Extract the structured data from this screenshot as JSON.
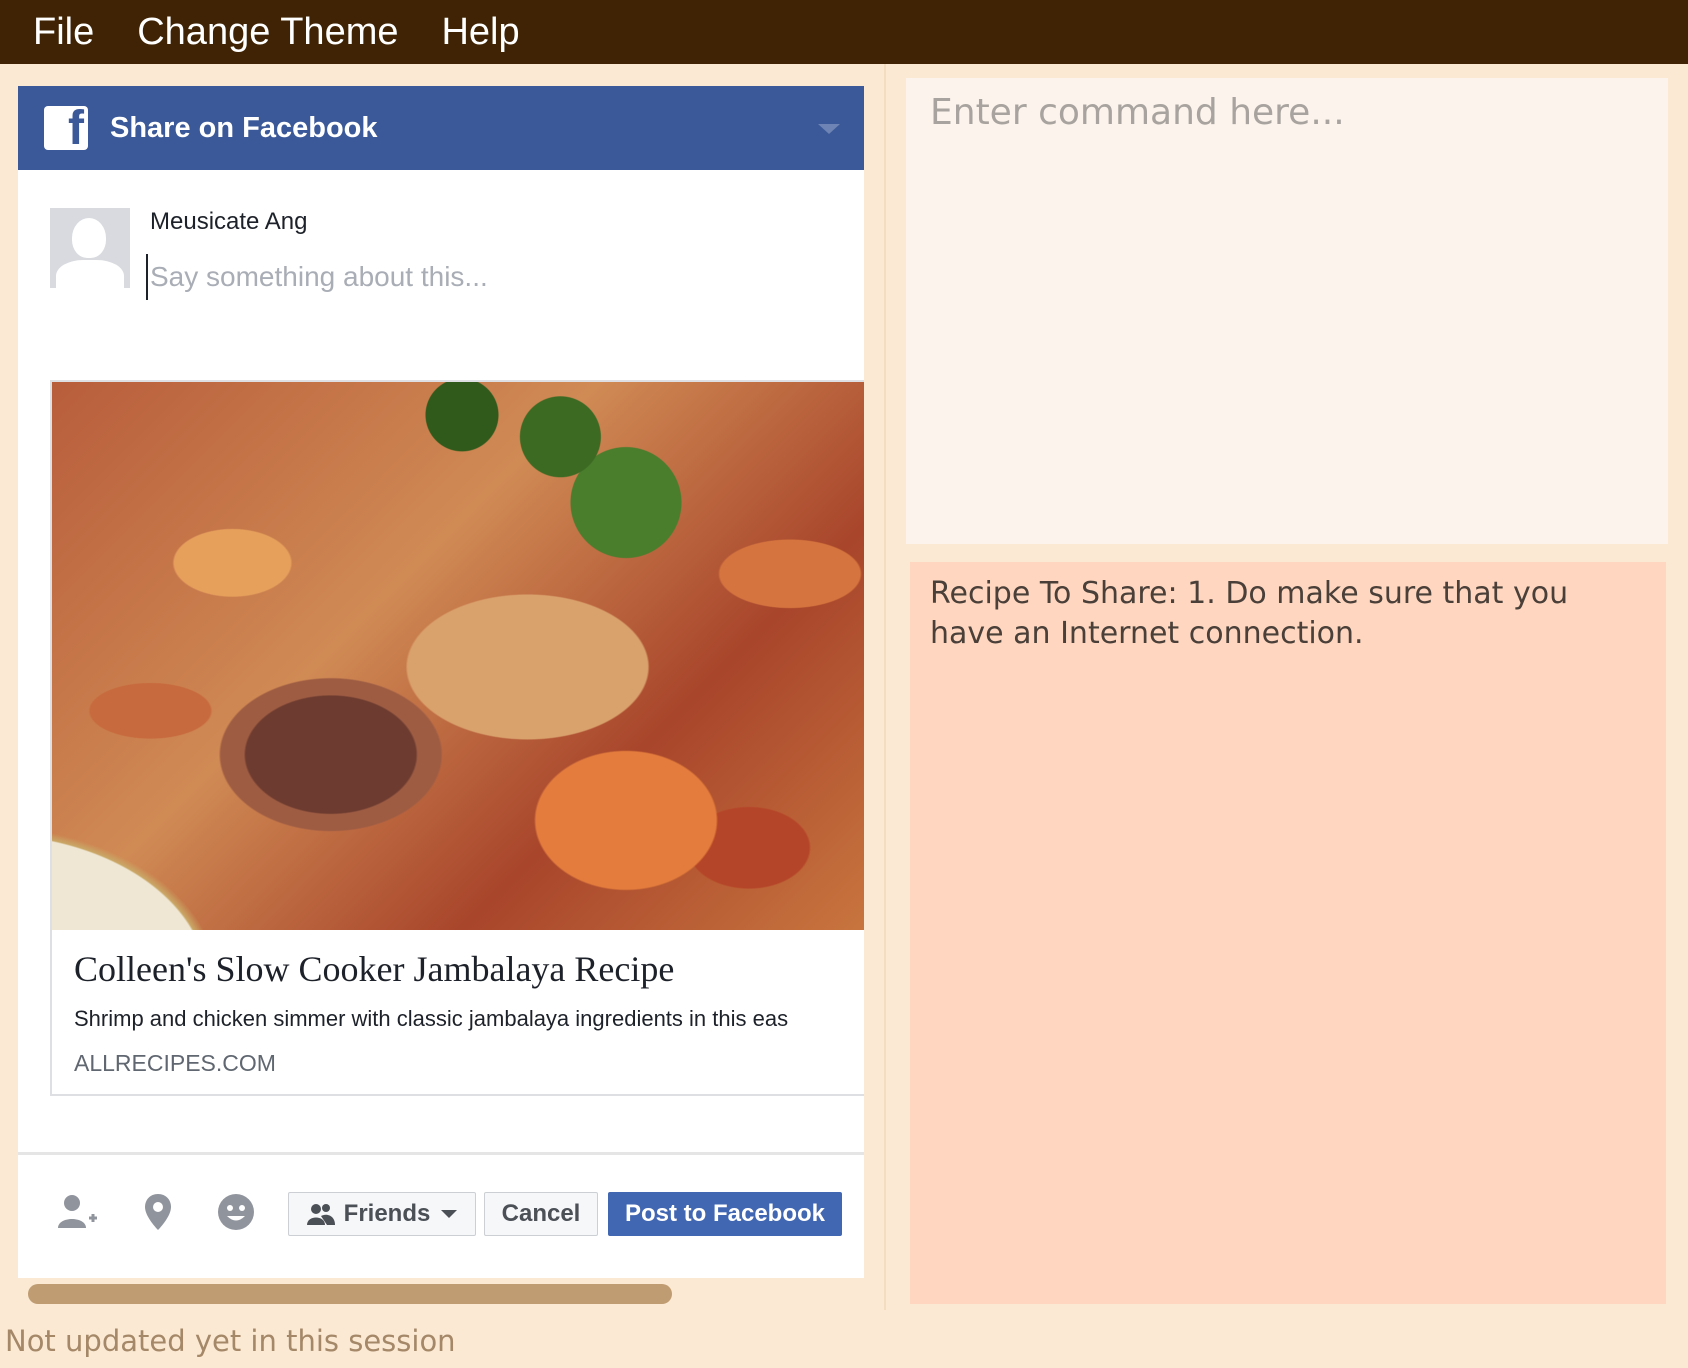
{
  "menubar": {
    "items": [
      "File",
      "Change Theme",
      "Help"
    ]
  },
  "share_dialog": {
    "header_title": "Share on Facebook",
    "logo_letter": "f",
    "user_name": "Meusicate Ang",
    "message_placeholder": "Say something about this...",
    "link": {
      "title": "Colleen's Slow Cooker Jambalaya Recipe",
      "description": "Shrimp and chicken simmer with classic jambalaya ingredients in this eas",
      "domain": "ALLRECIPES.COM"
    },
    "footer": {
      "audience_label": "Friends",
      "cancel_label": "Cancel",
      "post_label": "Post to Facebook"
    },
    "colors": {
      "facebook_blue": "#3b5998",
      "post_button": "#4267b2"
    }
  },
  "command": {
    "placeholder": "Enter command here..."
  },
  "result": {
    "text": "Recipe To Share: 1. Do make sure that you have an Internet connection."
  },
  "status": {
    "text": "Not updated yet in this session"
  },
  "theme": {
    "menubar_bg": "#3f2304",
    "app_bg": "#fbe9d4",
    "result_bg": "#ffd7c0"
  }
}
